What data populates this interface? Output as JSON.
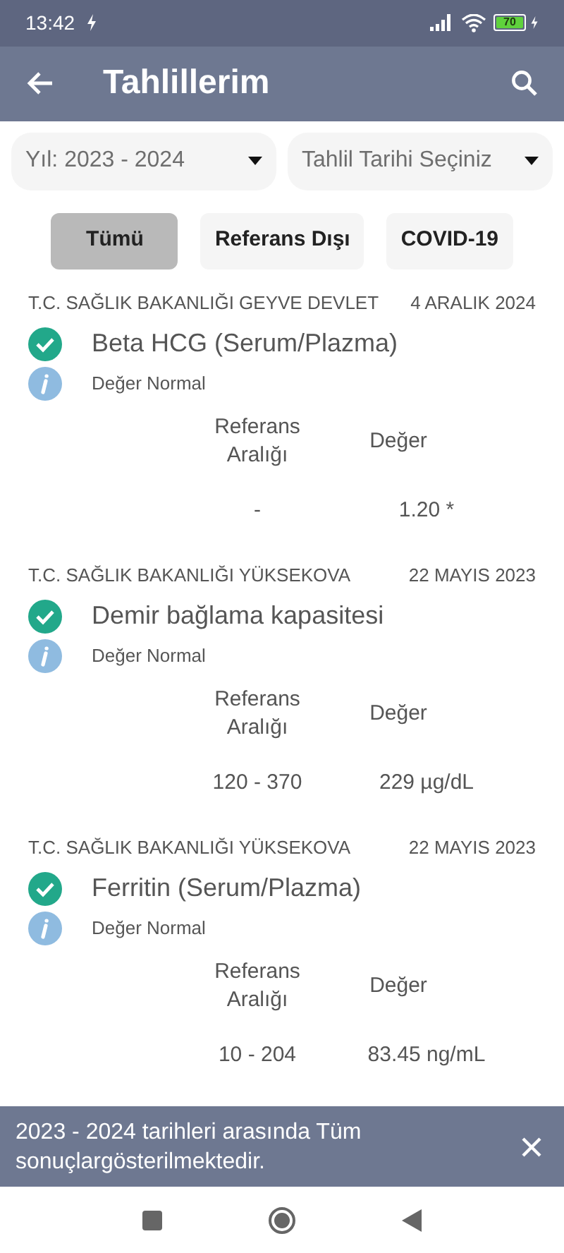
{
  "status_bar": {
    "time": "13:42",
    "battery": "70"
  },
  "app_bar": {
    "title": "Tahlillerim"
  },
  "filters": [
    {
      "label": "Yıl: 2023 - 2024"
    },
    {
      "label": "Tahlil Tarihi Seçiniz"
    }
  ],
  "chips": [
    {
      "label": "Tümü",
      "selected": true
    },
    {
      "label": "Referans Dışı",
      "selected": false
    },
    {
      "label": "COVID-19",
      "selected": false
    }
  ],
  "results": [
    {
      "hospital": "T.C. SAĞLIK BAKANLIĞI GEYVE DEVLET",
      "date": "4 ARALIK 2024",
      "test": "Beta HCG (Serum/Plazma)",
      "status": "Değer Normal",
      "range_header": "Referans\nAralığı",
      "value_header": "Değer",
      "range": "-",
      "value": "1.20 *"
    },
    {
      "hospital": "T.C. SAĞLIK BAKANLIĞI YÜKSEKOVA",
      "date": "22 MAYIS 2023",
      "test": "Demir bağlama kapasitesi",
      "status": "Değer Normal",
      "range_header": "Referans\nAralığı",
      "value_header": "Değer",
      "range": "120 - 370",
      "value": "229 µg/dL"
    },
    {
      "hospital": "T.C. SAĞLIK BAKANLIĞI YÜKSEKOVA",
      "date": "22 MAYIS 2023",
      "test": "Ferritin (Serum/Plazma)",
      "status": "Değer Normal",
      "range_header": "Referans\nAralığı",
      "value_header": "Değer",
      "range": "10 - 204",
      "value": "83.45 ng/mL"
    }
  ],
  "snackbar": {
    "message": "2023 - 2024 tarihleri arasında Tüm sonuçlargösterilmektedir."
  }
}
